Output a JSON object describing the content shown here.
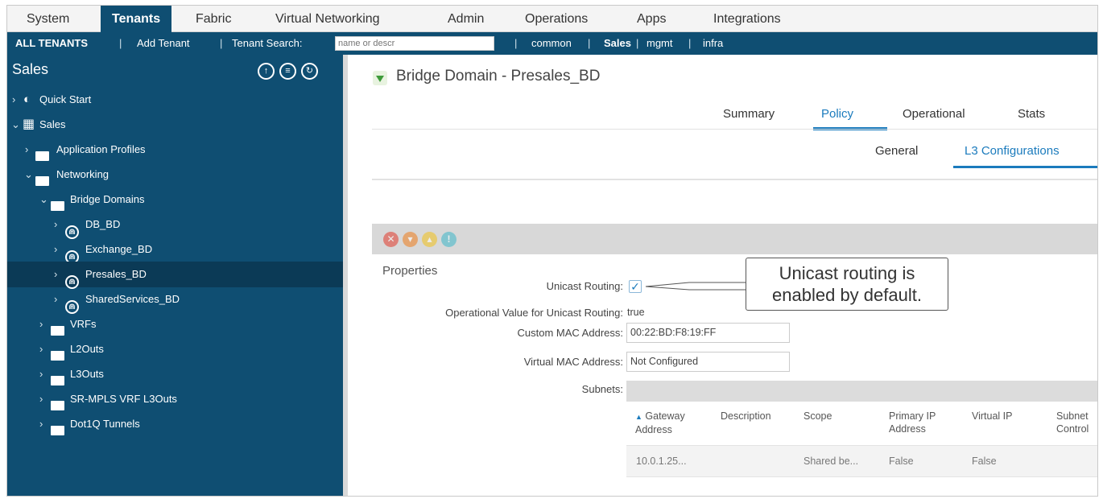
{
  "topnav": {
    "items": [
      "System",
      "Tenants",
      "Fabric",
      "Virtual Networking",
      "Admin",
      "Operations",
      "Apps",
      "Integrations"
    ],
    "active": "Tenants"
  },
  "subnav": {
    "all_tenants": "ALL TENANTS",
    "add_tenant": "Add Tenant",
    "tenant_search_label": "Tenant Search:",
    "search_placeholder": "name or descr",
    "tenants": [
      "common",
      "Sales",
      "mgmt",
      "infra"
    ],
    "active_tenant": "Sales",
    "separator": "|"
  },
  "sidebar": {
    "title": "Sales",
    "icon_names": [
      "deploy-icon",
      "list-icon",
      "refresh-icon"
    ],
    "tree": [
      {
        "label": "Quick Start",
        "icon": "quick-start-icon"
      },
      {
        "label": "Sales",
        "icon": "tenant-grid-icon"
      },
      {
        "label": "Application Profiles",
        "icon": "folder-icon"
      },
      {
        "label": "Networking",
        "icon": "folder-icon"
      },
      {
        "label": "Bridge Domains",
        "icon": "folder-icon"
      },
      {
        "label": "DB_BD",
        "icon": "bridge-domain-icon"
      },
      {
        "label": "Exchange_BD",
        "icon": "bridge-domain-icon"
      },
      {
        "label": "Presales_BD",
        "icon": "bridge-domain-icon",
        "selected": true
      },
      {
        "label": "SharedServices_BD",
        "icon": "bridge-domain-icon"
      },
      {
        "label": "VRFs",
        "icon": "folder-icon"
      },
      {
        "label": "L2Outs",
        "icon": "folder-icon"
      },
      {
        "label": "L3Outs",
        "icon": "folder-icon"
      },
      {
        "label": "SR-MPLS VRF L3Outs",
        "icon": "folder-icon"
      },
      {
        "label": "Dot1Q Tunnels",
        "icon": "folder-icon"
      }
    ]
  },
  "content": {
    "title": "Bridge Domain - Presales_BD",
    "tabs": [
      "Summary",
      "Policy",
      "Operational",
      "Stats"
    ],
    "active_tab": "Policy",
    "subtabs": [
      "General",
      "L3 Configurations"
    ],
    "active_subtab": "L3 Configurations",
    "toolbar_icons": [
      "fault-critical-icon",
      "fault-major-icon",
      "fault-minor-icon",
      "fault-warning-icon"
    ],
    "properties": {
      "heading": "Properties",
      "unicast_routing_label": "Unicast Routing:",
      "unicast_routing_checked": true,
      "operational_label": "Operational Value for Unicast Routing:",
      "operational_value": "true",
      "custom_mac_label": "Custom MAC Address:",
      "custom_mac_value": "00:22:BD:F8:19:FF",
      "virtual_mac_label": "Virtual MAC Address:",
      "virtual_mac_value": "Not Configured",
      "subnets_label": "Subnets:"
    },
    "callout": {
      "line1": "Unicast routing is",
      "line2": "enabled by default."
    },
    "subnet_table": {
      "columns": [
        "Gateway Address",
        "Description",
        "Scope",
        "Primary IP Address",
        "Virtual IP",
        "Subnet Control"
      ],
      "rows": [
        [
          "10.0.1.25...",
          "",
          "Shared be...",
          "False",
          "False",
          ""
        ]
      ]
    }
  },
  "colors": {
    "nav_blue": "#0f4e72",
    "accent": "#1b7bbd",
    "selected_row": "#0b3a56"
  }
}
